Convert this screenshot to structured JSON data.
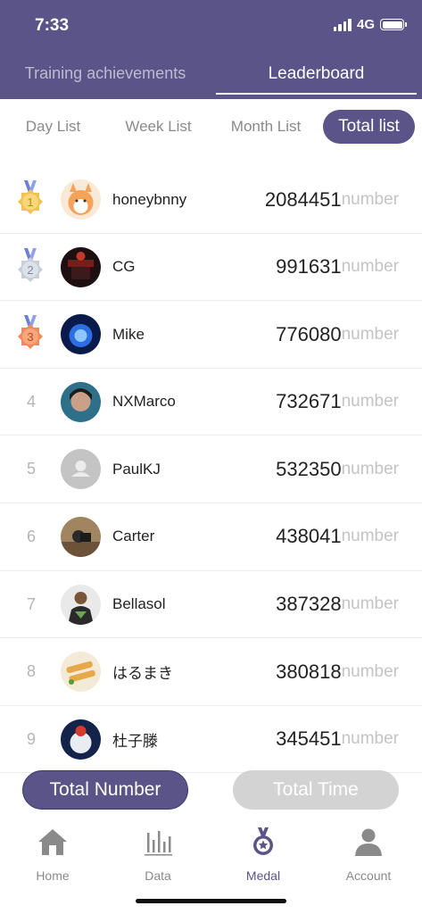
{
  "status_bar": {
    "time": "7:33",
    "network": "4G"
  },
  "top_tabs": {
    "achievements": "Training achievements",
    "leaderboard": "Leaderboard"
  },
  "period_tabs": {
    "day": "Day List",
    "week": "Week List",
    "month": "Month List",
    "total": "Total list"
  },
  "score_unit": "number",
  "leaderboard": [
    {
      "rank": "1",
      "name": "honeybnny",
      "score": "2084451"
    },
    {
      "rank": "2",
      "name": "CG",
      "score": "991631"
    },
    {
      "rank": "3",
      "name": "Mike",
      "score": "776080"
    },
    {
      "rank": "4",
      "name": "NXMarco",
      "score": "732671"
    },
    {
      "rank": "5",
      "name": "PaulKJ",
      "score": "532350"
    },
    {
      "rank": "6",
      "name": "Carter",
      "score": "438041"
    },
    {
      "rank": "7",
      "name": "Bellasol",
      "score": "387328"
    },
    {
      "rank": "8",
      "name": "はるまき",
      "score": "380818"
    },
    {
      "rank": "9",
      "name": "杜子滕",
      "score": "345451"
    }
  ],
  "sort_buttons": {
    "total_number": "Total Number",
    "total_time": "Total Time"
  },
  "tab_bar": {
    "home": "Home",
    "data": "Data",
    "medal": "Medal",
    "account": "Account"
  },
  "colors": {
    "primary": "#5b5488",
    "gold": "#f2c14e",
    "silver": "#c9cfd8",
    "bronze": "#f08a5d",
    "inactive": "#8a8a8a"
  },
  "icons": {
    "home": "home-icon",
    "data": "bar-chart-icon",
    "medal": "medal-icon",
    "account": "person-icon"
  }
}
